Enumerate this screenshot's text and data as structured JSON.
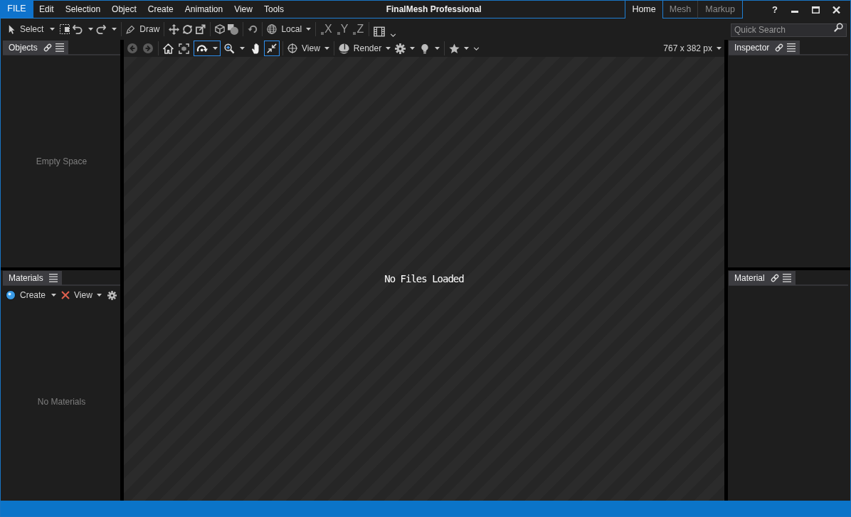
{
  "window": {
    "title": "FinalMesh Professional"
  },
  "title_bar": {
    "file_button": "FILE",
    "menu": [
      "Edit",
      "Selection",
      "Object",
      "Create",
      "Animation",
      "View",
      "Tools"
    ],
    "ribbon_tabs": [
      {
        "label": "Home",
        "selected": true
      },
      {
        "label": "Mesh",
        "selected": false
      },
      {
        "label": "Markup",
        "selected": false
      }
    ],
    "help_button": "?"
  },
  "toolbar": {
    "select_button": "Select",
    "draw_button": "Draw",
    "coordinate_space": "Local",
    "axis_buttons": [
      "X",
      "Y",
      "Z"
    ]
  },
  "quick_search": {
    "placeholder": "Quick Search"
  },
  "objects_panel": {
    "tab": "Objects",
    "empty_message": "Empty Space"
  },
  "viewport": {
    "tools": [
      {
        "kind": "orbit",
        "selected": true
      },
      {
        "kind": "zoom",
        "selected": false
      },
      {
        "kind": "pan",
        "selected": false
      },
      {
        "kind": "fit",
        "selected": true
      }
    ],
    "view_menu": "View",
    "render_menu": "Render",
    "viewport_size": "767 x 382 px",
    "message": "No Files Loaded"
  },
  "materials_panel": {
    "tab": "Materials",
    "create_button": "Create",
    "view_menu": "View",
    "empty_message": "No Materials"
  },
  "inspector_panel": {
    "tab": "Inspector"
  },
  "material_panel": {
    "tab": "Material"
  }
}
